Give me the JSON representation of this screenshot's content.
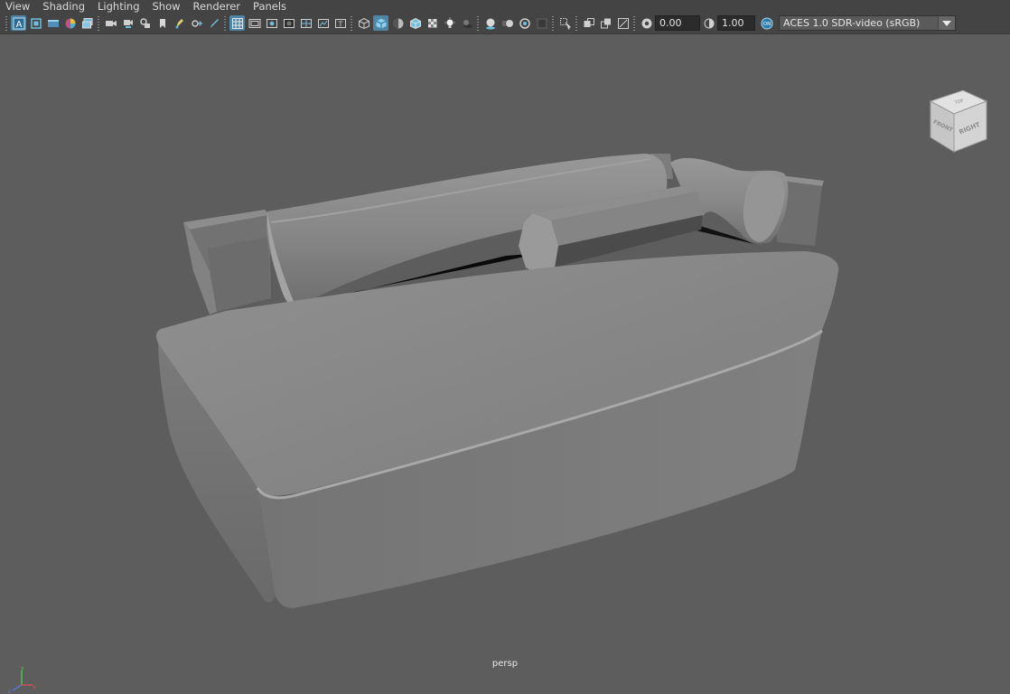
{
  "menubar": {
    "items": [
      {
        "label": "View"
      },
      {
        "label": "Shading"
      },
      {
        "label": "Lighting"
      },
      {
        "label": "Show"
      },
      {
        "label": "Renderer"
      },
      {
        "label": "Panels"
      }
    ]
  },
  "toolbar": {
    "select_camera_icon": "select-camera-icon",
    "exposure_value": "0.00",
    "gamma_value": "1.00",
    "color_management_badge": "ON",
    "view_transform": "ACES 1.0 SDR-video (sRGB)"
  },
  "viewcube": {
    "top_label": "TOP",
    "front_label": "FRONT",
    "right_label": "RIGHT"
  },
  "viewport": {
    "camera_label": "persp"
  },
  "colors": {
    "background": "#5d5d5d",
    "toolbar": "#444444",
    "accent": "#4f86a6",
    "model": "#8a8a8a"
  }
}
